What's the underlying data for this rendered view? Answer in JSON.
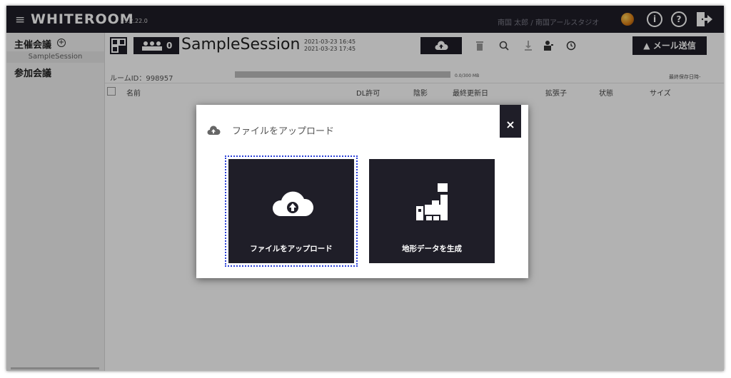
{
  "app": {
    "brand": "WHITEROOM",
    "version": "v1.2.22.0",
    "user": "南国 太郎 / 南国アールスタジオ",
    "info_label": "i",
    "help_label": "?"
  },
  "sidebar": {
    "host_label": "主催会議",
    "plus_symbol": "+",
    "session_name": "SampleSession",
    "joined_label": "参加会議"
  },
  "session": {
    "member_count": "0",
    "title": "SampleSession",
    "created": "2021-03-23 16:45",
    "updated": "2021-03-23 17:45",
    "room_id": "ルームID：998957",
    "storage": "0.0/300 MB",
    "storage_used_fraction": 0.0,
    "last_saved": "最終保存日時-",
    "mail_button": "メール送信"
  },
  "table": {
    "columns": [
      "名前",
      "DL許可",
      "陰影",
      "最終更新日",
      "拡張子",
      "状態",
      "サイズ"
    ]
  },
  "modal": {
    "title": "ファイルをアップロード",
    "close_label": "×",
    "options": [
      {
        "label": "ファイルをアップロード",
        "icon": "cloud-upload-icon"
      },
      {
        "label": "地形データを生成",
        "icon": "terrain-blocks-icon"
      }
    ]
  },
  "colors": {
    "dark": "#1f1e28",
    "focus_outline": "#2a3fd8"
  }
}
